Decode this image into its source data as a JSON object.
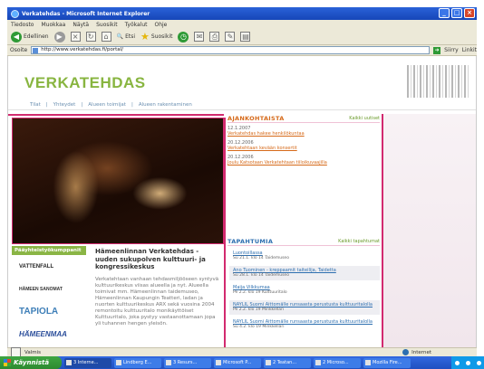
{
  "window": {
    "title": "Verkatehdas - Microsoft Internet Explorer"
  },
  "menu": [
    "Tiedosto",
    "Muokkaa",
    "Näytä",
    "Suosikit",
    "Työkalut",
    "Ohje"
  ],
  "toolbar": {
    "back": "Edellinen",
    "search": "Etsi",
    "favorites": "Suosikit"
  },
  "address": {
    "label": "Osoite",
    "url": "http://www.verkatehdas.fi/portal/",
    "go": "Siirry",
    "links": "Linkit"
  },
  "site": {
    "logo": "VERKATEHDAS",
    "nav": [
      "Tilat",
      "Yhteydet",
      "Alueen toimijat",
      "Alueen rakentaminen"
    ]
  },
  "partners": {
    "label": "Pääyhteistyökumppanit",
    "items": [
      "VATTENFALL",
      "HÄMEEN SANOMAT",
      "TAPIOLA",
      "HÄMEENMAA"
    ]
  },
  "about": {
    "title": "Hämeenlinnan Verkatehdas - uuden sukupolven kulttuuri- ja kongressikeskus",
    "body": "Verkatehtaan vanhaan tehdasmiljööseen syntyvä kulttuurikeskus viisas alueella ja nyt. Alueella toimivat mm. Hämeenlinnan taidemuseo, Hämeenlinnan Kaupungin Teatteri, ladan ja nuorten kulttuurikeskus ARX sekä vuosina 2004 remontoitu kulttuuritalo monikäyttöiset Kulttuuritalo, joka pystyy vastaanottamaan jopa yli tuhannen hengen yleisön."
  },
  "news": {
    "title": "AJANKOHTAISTA",
    "more": "Kaikki uutiset",
    "items": [
      {
        "date": "12.1.2007",
        "link": "Verkatehdas hakee henkilökuntaa"
      },
      {
        "date": "20.12.2006",
        "link": "Verkatehtaan kevään konsertit"
      },
      {
        "date": "20.12.2006",
        "link": "Joulu Katsotaan Verkatehtaan tiiloikuvaajilla"
      }
    ]
  },
  "events": {
    "title": "TAPAHTUMIA",
    "more": "Kaikki tapahtumat",
    "items": [
      {
        "title": "Luontoillassa",
        "date": "Su 21.1. klo 14 Taidemuseo"
      },
      {
        "title": "Ano Tuominen - kreppaamit taiteilija, Taidetta",
        "date": "Su 28.1. klo 14 Taidemuseo"
      },
      {
        "title": "Maija Vilkkumaa",
        "date": "Pe 2.2. klo 19 Kulttuuritalo"
      },
      {
        "title": "NAYLIL Suomi Aittomälle runsaasta perustusta kulttuuritalolla",
        "date": "Pe 2.2. klo 19 Minkkellari"
      },
      {
        "title": "NAYLIL Suomi Aittomälle runsaasta perustusta kulttuuritalolla",
        "date": "Su 4.2. klo 19 Minkkellari"
      }
    ]
  },
  "status": {
    "left": "Valmis",
    "zone": "Internet"
  },
  "taskbar": {
    "start": "Käynnistä",
    "tasks": [
      "3 Interne...",
      "Lindberg E...",
      "3 Resurs...",
      "Microsoft P...",
      "2 Teatan...",
      "2 Microso...",
      "Mozilla Fire..."
    ]
  },
  "colors": {
    "accent_pink": "#d22a6f",
    "logo_green": "#88b540",
    "orange": "#d66a1a",
    "link_blue": "#2d6fb0"
  }
}
